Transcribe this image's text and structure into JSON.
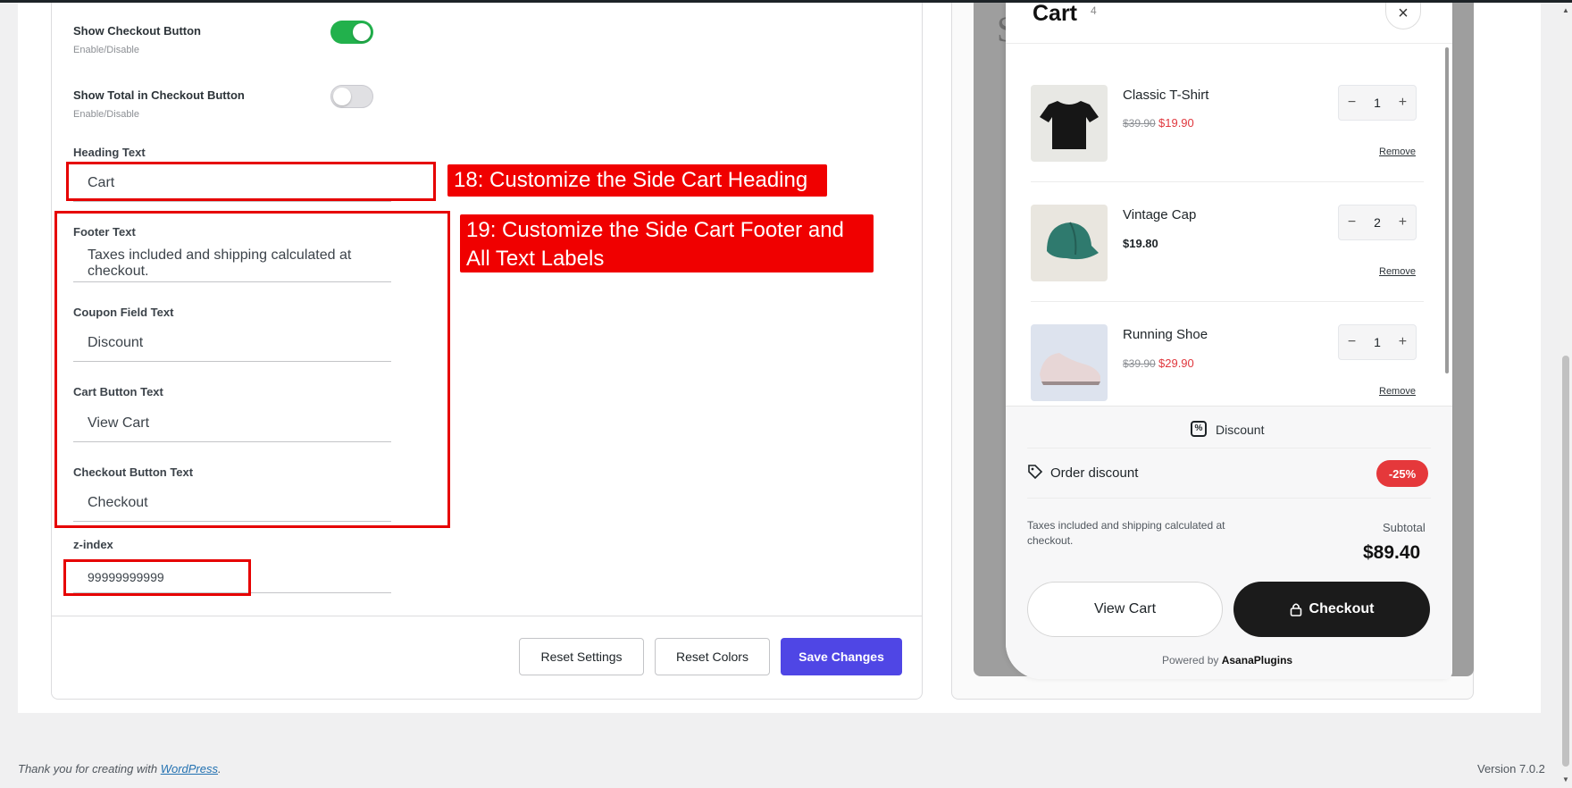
{
  "settings": {
    "show_checkout": {
      "label": "Show Checkout Button",
      "hint": "Enable/Disable",
      "enabled": true
    },
    "show_total": {
      "label": "Show Total in Checkout Button",
      "hint": "Enable/Disable",
      "enabled": false
    },
    "heading": {
      "label": "Heading Text",
      "value": "Cart"
    },
    "footer_text": {
      "label": "Footer Text",
      "value": "Taxes included and shipping calculated at checkout."
    },
    "coupon_text": {
      "label": "Coupon Field Text",
      "value": "Discount"
    },
    "cart_button_text": {
      "label": "Cart Button Text",
      "value": "View Cart"
    },
    "checkout_button_text": {
      "label": "Checkout Button Text",
      "value": "Checkout"
    },
    "z_index": {
      "label": "z-index",
      "value": "99999999999"
    }
  },
  "callouts": {
    "c18": "18: Customize the Side Cart Heading",
    "c19_line1": "19: Customize the Side Cart Footer and",
    "c19_line2": "All Text Labels"
  },
  "actions": {
    "reset_settings": "Reset Settings",
    "reset_colors": "Reset Colors",
    "save_changes": "Save Changes"
  },
  "preview": {
    "bg_letter": "S",
    "cart": {
      "title": "Cart",
      "count": "4",
      "close": "×",
      "items": [
        {
          "name": "Classic T-Shirt",
          "old_price": "$39.90",
          "price": "$19.90",
          "qty": "1",
          "remove": "Remove"
        },
        {
          "name": "Vintage Cap",
          "old_price": "",
          "price": "$19.80",
          "qty": "2",
          "remove": "Remove"
        },
        {
          "name": "Running Shoe",
          "old_price": "$39.90",
          "price": "$29.90",
          "qty": "1",
          "remove": "Remove"
        }
      ],
      "qty_minus": "−",
      "qty_plus": "+",
      "discount_label": "Discount",
      "order_discount_label": "Order discount",
      "order_discount_badge": "-25%",
      "footer_note": "Taxes included and shipping calculated at checkout.",
      "subtotal_label": "Subtotal",
      "subtotal_value": "$89.40",
      "view_cart": "View Cart",
      "checkout": "Checkout",
      "powered_prefix": "Powered by",
      "powered_brand": "AsanaPlugins"
    }
  },
  "footer": {
    "thanks_prefix": "Thank you for creating with",
    "link": "WordPress",
    "suffix": ".",
    "version": "Version 7.0.2"
  },
  "colors": {
    "accent": "#4f46e5",
    "toggle_on": "#22b14c",
    "annotation_red": "#e60000",
    "sale_red": "#e0383e",
    "badge_red": "#e5383b"
  }
}
